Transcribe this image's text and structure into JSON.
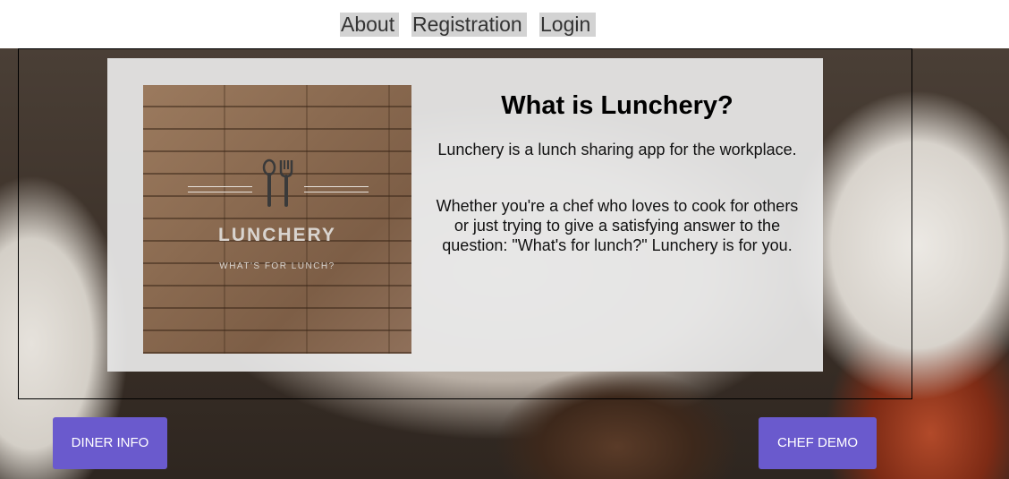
{
  "nav": {
    "about": "About",
    "registration": "Registration",
    "login": "Login"
  },
  "logo": {
    "name": "LUNCHERY",
    "tagline": "WHAT'S FOR LUNCH?"
  },
  "card": {
    "title": "What is Lunchery?",
    "paragraph1": "Lunchery is a lunch sharing app for the workplace.",
    "paragraph2": "Whether you're a chef who loves to cook for others or just trying to give a satisfying answer to the question: \"What's for lunch?\" Lunchery is for you."
  },
  "buttons": {
    "diner": "DINER INFO",
    "chef": "CHEF DEMO"
  },
  "colors": {
    "nav_bg": "#d3d3d3",
    "button_bg": "#6a5acd",
    "card_bg": "#e8e8e8"
  },
  "icons": {
    "logo_icon": "fork-and-spoon-icon"
  }
}
